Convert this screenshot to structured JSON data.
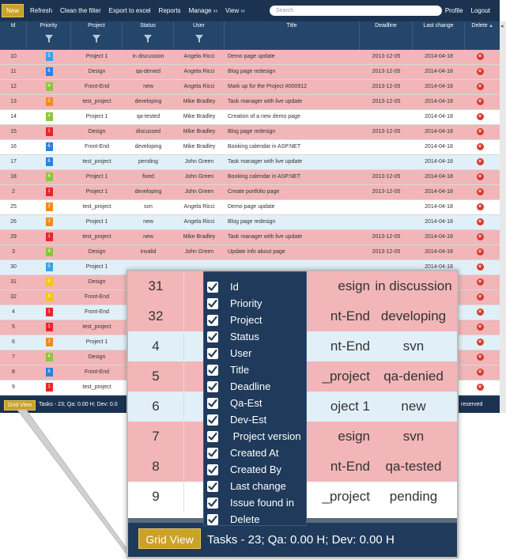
{
  "toolbar": {
    "new": "New",
    "refresh": "Refresh",
    "clean_filter": "Clean the filter",
    "export": "Export to excel",
    "reports": "Reports",
    "manage": "Manage",
    "manage_arrow": "››",
    "view": "View",
    "view_arrow": "››",
    "search_placeholder": "Search",
    "profile": "Profile",
    "logout": "Logout"
  },
  "columns": {
    "id": "Id",
    "priority": "Priority",
    "project": "Project",
    "status": "Status",
    "user": "User",
    "title": "Title",
    "deadline": "Deadline",
    "last_change": "Last change",
    "delete": "Delete",
    "sort_arrow": "▲"
  },
  "colors": {
    "priority": {
      "1": "#e8262b",
      "2": "#f28a1e",
      "4": "#8cc63f",
      "5": "#3aa0e8",
      "6": "#2e7fe0",
      "yellow": "#f5c518"
    },
    "row_pink": "#f2b6b8",
    "row_blue": "#e1f0f8",
    "accent": "#c9a227",
    "header": "#1f3a5a"
  },
  "rows": [
    {
      "id": "10",
      "pri": "5",
      "pri_color": "#3aa0e8",
      "project": "Project 1",
      "status": "in discussion",
      "user": "Angela Ricci",
      "title": "Demo page update",
      "deadline": "2013-12-05",
      "last_change": "2014-04-18",
      "bg": "pink"
    },
    {
      "id": "11",
      "pri": "6",
      "pri_color": "#2e7fe0",
      "project": "Design",
      "status": "qa-denied",
      "user": "Angela Ricci",
      "title": "Blog page redesign",
      "deadline": "2013-12-05",
      "last_change": "2014-04-18",
      "bg": "pink"
    },
    {
      "id": "12",
      "pri": "4",
      "pri_color": "#8cc63f",
      "project": "Front-End",
      "status": "new",
      "user": "Angela Ricci",
      "title": "Mark up for the Project #000912",
      "deadline": "2013-12-05",
      "last_change": "2014-04-18",
      "bg": "pink"
    },
    {
      "id": "13",
      "pri": "2",
      "pri_color": "#f28a1e",
      "project": "test_project",
      "status": "developing",
      "user": "Mike Bradley",
      "title": "Task manager with live update",
      "deadline": "2013-12-05",
      "last_change": "2014-04-18",
      "bg": "pink"
    },
    {
      "id": "14",
      "pri": "4",
      "pri_color": "#8cc63f",
      "project": "Project 1",
      "status": "qa-tested",
      "user": "Mike Bradley",
      "title": "Creation of a new demo page",
      "deadline": "",
      "last_change": "2014-04-18",
      "bg": "white"
    },
    {
      "id": "15",
      "pri": "1",
      "pri_color": "#e8262b",
      "project": "Design",
      "status": "discussed",
      "user": "Mike Bradley",
      "title": "Blog page redesign",
      "deadline": "2013-12-05",
      "last_change": "2014-04-18",
      "bg": "pink"
    },
    {
      "id": "16",
      "pri": "6",
      "pri_color": "#2e7fe0",
      "project": "Front-End",
      "status": "developing",
      "user": "Mike Bradley",
      "title": "Booking calendar in ASP.NET",
      "deadline": "",
      "last_change": "2014-04-18",
      "bg": "white"
    },
    {
      "id": "17",
      "pri": "6",
      "pri_color": "#2e7fe0",
      "project": "test_project",
      "status": "pending",
      "user": "John Green",
      "title": "Task manager with live update",
      "deadline": "",
      "last_change": "2014-04-18",
      "bg": "blue"
    },
    {
      "id": "18",
      "pri": "4",
      "pri_color": "#8cc63f",
      "project": "Project 1",
      "status": "fixed",
      "user": "John Green",
      "title": "Booking calendar in ASP.NET",
      "deadline": "2013-12-05",
      "last_change": "2014-04-18",
      "bg": "pink"
    },
    {
      "id": "2",
      "pri": "1",
      "pri_color": "#e8262b",
      "project": "Project 1",
      "status": "developing",
      "user": "John Green",
      "title": "Create portfolio page",
      "deadline": "2013-12-05",
      "last_change": "2014-04-18",
      "bg": "pink"
    },
    {
      "id": "25",
      "pri": "2",
      "pri_color": "#f28a1e",
      "project": "test_project",
      "status": "svn",
      "user": "Angela Ricci",
      "title": "Demo page update",
      "deadline": "",
      "last_change": "2014-04-18",
      "bg": "white"
    },
    {
      "id": "26",
      "pri": "2",
      "pri_color": "#f28a1e",
      "project": "Project 1",
      "status": "new",
      "user": "Angela Ricci",
      "title": "Blog page redesign",
      "deadline": "",
      "last_change": "2014-04-18",
      "bg": "blue"
    },
    {
      "id": "29",
      "pri": "1",
      "pri_color": "#e8262b",
      "project": "test_project",
      "status": "new",
      "user": "Mike Bradley",
      "title": "Task manager with live update",
      "deadline": "2013-12-05",
      "last_change": "2014-04-18",
      "bg": "pink"
    },
    {
      "id": "3",
      "pri": "4",
      "pri_color": "#8cc63f",
      "project": "Design",
      "status": "invalid",
      "user": "John Green",
      "title": "Update info about page",
      "deadline": "2013-12-05",
      "last_change": "2014-04-18",
      "bg": "pink"
    },
    {
      "id": "30",
      "pri": "5",
      "pri_color": "#3aa0e8",
      "project": "Project 1",
      "status": "",
      "user": "",
      "title": "",
      "deadline": "",
      "last_change": "2014-04-18",
      "bg": "blue"
    },
    {
      "id": "31",
      "pri": "4",
      "pri_color": "#f5c518",
      "project": "Design",
      "status": "",
      "user": "",
      "title": "",
      "deadline": "",
      "last_change": "2014-04-18",
      "bg": "pink"
    },
    {
      "id": "32",
      "pri": "4",
      "pri_color": "#f5c518",
      "project": "Front-End",
      "status": "",
      "user": "",
      "title": "",
      "deadline": "",
      "last_change": "2014-04-18",
      "bg": "pink"
    },
    {
      "id": "4",
      "pri": "1",
      "pri_color": "#e8262b",
      "project": "Front-End",
      "status": "",
      "user": "",
      "title": "",
      "deadline": "",
      "last_change": "2014-04-18",
      "bg": "blue"
    },
    {
      "id": "5",
      "pri": "1",
      "pri_color": "#e8262b",
      "project": "test_project",
      "status": "",
      "user": "",
      "title": "",
      "deadline": "",
      "last_change": "2014-04-18",
      "bg": "pink"
    },
    {
      "id": "6",
      "pri": "2",
      "pri_color": "#f28a1e",
      "project": "Project 1",
      "status": "",
      "user": "",
      "title": "",
      "deadline": "",
      "last_change": "2014-04-18",
      "bg": "blue"
    },
    {
      "id": "7",
      "pri": "4",
      "pri_color": "#8cc63f",
      "project": "Design",
      "status": "",
      "user": "",
      "title": "",
      "deadline": "",
      "last_change": "2014-04-18",
      "bg": "pink"
    },
    {
      "id": "8",
      "pri": "6",
      "pri_color": "#2e7fe0",
      "project": "Front-End",
      "status": "",
      "user": "",
      "title": "",
      "deadline": "",
      "last_change": "2014-04-18",
      "bg": "pink"
    },
    {
      "id": "9",
      "pri": "1",
      "pri_color": "#e8262b",
      "project": "test_project",
      "status": "",
      "user": "",
      "title": "",
      "deadline": "",
      "last_change": "2014-04-18",
      "bg": "white"
    }
  ],
  "statusbar": {
    "grid_view": "Grid View",
    "tasks": "Tasks - 23; Qa: 0.00 H; Dev: 0.0",
    "reserved": "reserved"
  },
  "zoom": {
    "rows": [
      {
        "id": "31",
        "project": "esign",
        "status": "in discussion",
        "bg": "pink"
      },
      {
        "id": "32",
        "project": "nt-End",
        "status": "developing",
        "bg": "pink"
      },
      {
        "id": "4",
        "project": "nt-End",
        "status": "svn",
        "bg": "blue"
      },
      {
        "id": "5",
        "project": "_project",
        "status": "qa-denied",
        "bg": "pink"
      },
      {
        "id": "6",
        "project": "oject 1",
        "status": "new",
        "bg": "blue"
      },
      {
        "id": "7",
        "project": "esign",
        "status": "svn",
        "bg": "pink"
      },
      {
        "id": "8",
        "project": "nt-End",
        "status": "qa-tested",
        "bg": "pink"
      },
      {
        "id": "9",
        "project": "_project",
        "status": "pending",
        "bg": "white"
      }
    ],
    "grid_view": "Grid View",
    "tasks": "Tasks - 23; Qa: 0.00 H; Dev: 0.00 H"
  },
  "column_menu": [
    {
      "label": "Id",
      "checked": true
    },
    {
      "label": "Priority",
      "checked": true
    },
    {
      "label": "Project",
      "checked": true
    },
    {
      "label": "Status",
      "checked": true
    },
    {
      "label": "User",
      "checked": true
    },
    {
      "label": "Title",
      "checked": true
    },
    {
      "label": "Deadline",
      "checked": true
    },
    {
      "label": "Qa-Est",
      "checked": true
    },
    {
      "label": "Dev-Est",
      "checked": true
    },
    {
      "label": " Project version",
      "checked": true
    },
    {
      "label": "Created At",
      "checked": true
    },
    {
      "label": "Created By",
      "checked": true
    },
    {
      "label": "Last change",
      "checked": true
    },
    {
      "label": "Issue found in",
      "checked": true
    },
    {
      "label": "Delete",
      "checked": true
    }
  ],
  "icons": {
    "delete": "delete-icon",
    "filter": "filter-funnel-icon",
    "checkbox": "checkbox-checked-icon"
  }
}
